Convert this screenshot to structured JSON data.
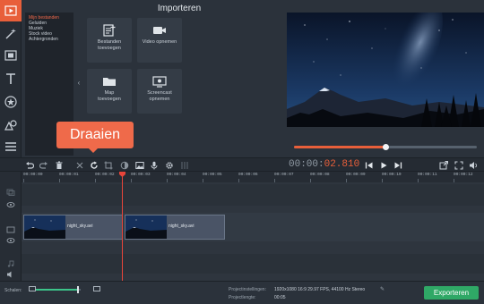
{
  "importer": {
    "title": "Importeren",
    "categories": [
      {
        "label": "Mijn bestanden",
        "selected": true
      },
      {
        "label": "Geluiden",
        "selected": false
      },
      {
        "label": "Muziek",
        "selected": false
      },
      {
        "label": "Stock video",
        "selected": false
      },
      {
        "label": "Achtergronden",
        "selected": false
      }
    ],
    "tiles": {
      "add_files": "Bestanden\ntoevoegen",
      "record_video": "Video opnemen",
      "add_folder": "Map\ntoevoegen",
      "screencast": "Screencast\nopnemen"
    }
  },
  "tooltip": {
    "label": "Draaien"
  },
  "player": {
    "timecode_prefix": "00:00:",
    "timecode_value": "02.810",
    "progress": 0.5
  },
  "timeline": {
    "ruler": [
      "00:00:00",
      "00:00:01",
      "00:00:02",
      "00:00:03",
      "00:00:04",
      "00:00:05",
      "00:00:06",
      "00:00:07",
      "00:00:08",
      "00:00:09",
      "00:00:10",
      "00:00:11",
      "00:00:12"
    ],
    "clips": [
      {
        "name": "night_sky.avi"
      },
      {
        "name": "night_sky.avi"
      }
    ]
  },
  "bottom": {
    "scale_label": "Schalen:",
    "zoom_level": 0.92,
    "settings_label": "Projectinstellingen:",
    "settings_value": "1920x1080 16:9 29.97 FPS, 44100 Hz Stereo",
    "length_label": "Projectlengte:",
    "length_value": "00:05",
    "export_label": "Exporteren"
  },
  "colors": {
    "accent": "#e85f3a",
    "export": "#2fa866",
    "zoom": "#3cc48a"
  }
}
